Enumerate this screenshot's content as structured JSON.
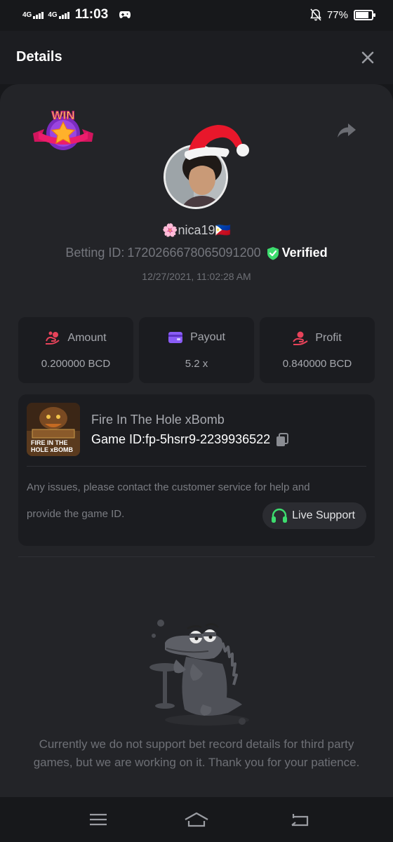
{
  "status_bar": {
    "network1": "4G",
    "network2": "4G",
    "time": "11:03",
    "battery": "77%",
    "battery_level": 0.77
  },
  "header": {
    "title": "Details"
  },
  "profile": {
    "badge_text": "WIN",
    "username": "🌸nica19🇵🇭",
    "betting_id_label": "Betting ID:",
    "betting_id": "1720266678065091200",
    "verified": "Verified",
    "date": "12/27/2021, 11:02:28 AM"
  },
  "stats": [
    {
      "label": "Amount",
      "value": "0.200000 BCD",
      "icon": "coins-icon",
      "color": "#e8435a"
    },
    {
      "label": "Payout",
      "value": "5.2 x",
      "icon": "wallet-icon",
      "color": "#8a5cf6"
    },
    {
      "label": "Profit",
      "value": "0.840000 BCD",
      "icon": "money-hand-icon",
      "color": "#e8435a"
    }
  ],
  "game": {
    "name": "Fire In The Hole xBomb",
    "id_label": "Game ID:",
    "id": "fp-5hsrr9-2239936522",
    "thumb_title": "FIRE IN THE",
    "thumb_title2": "HOLE xBOMB",
    "help_line1": "Any issues, please contact the customer service for help and",
    "help_line2": "provide the game ID.",
    "support_label": "Live Support"
  },
  "notice": "Currently we do not support bet record details for third party games, but we are working on it. Thank you for your patience.",
  "colors": {
    "accent_green": "#3ddc6e",
    "background": "#17181b",
    "panel": "#232428",
    "card": "#1b1c20"
  }
}
